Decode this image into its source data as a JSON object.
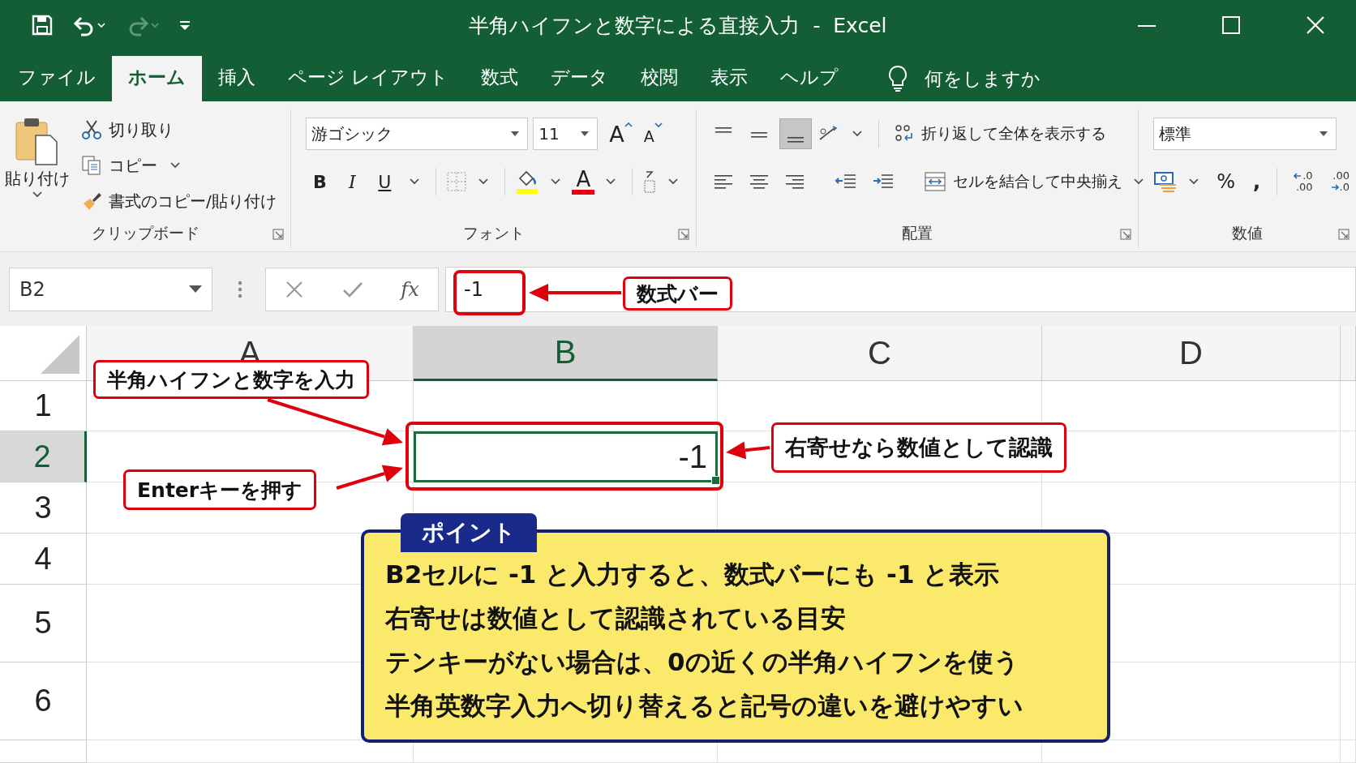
{
  "window": {
    "title": "半角ハイフンと数字による直接入力  -  Excel"
  },
  "quick_access": [
    {
      "kind": "save",
      "disabled": false
    },
    {
      "kind": "undo",
      "disabled": false
    },
    {
      "kind": "redo",
      "disabled": true
    },
    {
      "kind": "customize",
      "disabled": false
    }
  ],
  "tabs": [
    {
      "label": "ファイル",
      "selected": false
    },
    {
      "label": "ホーム",
      "selected": true
    },
    {
      "label": "挿入",
      "selected": false
    },
    {
      "label": "ページ レイアウト",
      "selected": false
    },
    {
      "label": "数式",
      "selected": false
    },
    {
      "label": "データ",
      "selected": false
    },
    {
      "label": "校閲",
      "selected": false
    },
    {
      "label": "表示",
      "selected": false
    },
    {
      "label": "ヘルプ",
      "selected": false
    }
  ],
  "tell_me": {
    "placeholder": "何をしますか"
  },
  "ribbon": {
    "clipboard": {
      "label": "クリップボード",
      "paste": "貼り付け",
      "cut": "切り取り",
      "copy": "コピー",
      "format_painter": "書式のコピー/貼り付け"
    },
    "font": {
      "label": "フォント",
      "font_name": "游ゴシック",
      "font_size": "11",
      "grow": "A",
      "shrink": "A",
      "bold": "B",
      "italic": "I",
      "underline": "U",
      "font_color": "A"
    },
    "alignment": {
      "label": "配置",
      "vertical": [
        {
          "kind": "top",
          "selected": false
        },
        {
          "kind": "middle",
          "selected": false
        },
        {
          "kind": "bottom",
          "selected": true
        }
      ],
      "wrap_text": "折り返して全体を表示する",
      "merge_center": "セルを結合して中央揃え"
    },
    "number": {
      "label": "数値",
      "format": "標準",
      "percent": "%",
      "comma": ",",
      "increase_decimal": [
        ".0",
        ".00"
      ],
      "decrease_decimal": [
        ".00",
        ".0"
      ]
    }
  },
  "formula_bar": {
    "name_box": "B2",
    "function_label": "fx",
    "value": "-1"
  },
  "sheet": {
    "columns": [
      {
        "label": "A",
        "selected": false
      },
      {
        "label": "B",
        "selected": true
      },
      {
        "label": "C",
        "selected": false
      },
      {
        "label": "D",
        "selected": false
      }
    ],
    "rows": [
      {
        "label": "1",
        "selected": false
      },
      {
        "label": "2",
        "selected": true
      },
      {
        "label": "3",
        "selected": false
      },
      {
        "label": "4",
        "selected": false
      },
      {
        "label": "5",
        "selected": false
      },
      {
        "label": "6",
        "selected": false
      }
    ],
    "active_cell": {
      "value": "-1"
    }
  },
  "callouts": [
    {
      "kind": "formula-bar",
      "text": "数式バー"
    },
    {
      "kind": "input",
      "text": "半角ハイフンと数字を入力"
    },
    {
      "kind": "right-align",
      "text": "右寄せなら数値として認識"
    },
    {
      "kind": "enter",
      "text": "Enterキーを押す"
    }
  ],
  "point": {
    "tag": "ポイント",
    "lines": [
      "B2セルに -1 と入力すると、数式バーにも -1 と表示",
      "右寄せは数値として認識されている目安",
      "テンキーがない場合は、0の近くの半角ハイフンを使う",
      "半角英数字入力へ切り替えると記号の違いを避けやすい"
    ]
  }
}
